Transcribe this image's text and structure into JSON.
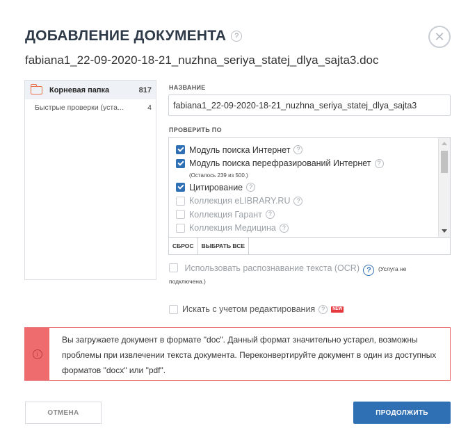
{
  "dialog": {
    "title": "ДОБАВЛЕНИЕ ДОКУМЕНТА",
    "help_icon": "question-icon",
    "close_icon": "close-icon",
    "close_glyph": "✕",
    "filename": "fabiana1_22-09-2020-18-21_nuzhna_seriya_statej_dlya_sajta3.doc"
  },
  "folders": {
    "root": {
      "label": "Корневая папка",
      "count": "817",
      "icon": "folder-icon"
    },
    "items": [
      {
        "label": "Быстрые проверки (уста...",
        "count": "4"
      }
    ]
  },
  "name_section": {
    "label": "НАЗВАНИЕ",
    "value": "fabiana1_22-09-2020-18-21_nuzhna_seriya_statej_dlya_sajta3"
  },
  "check_section": {
    "label": "ПРОВЕРИТЬ ПО",
    "items": [
      {
        "label": "Модуль поиска Интернет",
        "checked": true
      },
      {
        "label": "Модуль поиска перефразирований Интернет",
        "checked": true,
        "note": "(Осталось 239 из 500.)"
      },
      {
        "label": "Цитирование",
        "checked": true
      },
      {
        "label": "Коллекция eLIBRARY.RU",
        "checked": false
      },
      {
        "label": "Коллекция Гарант",
        "checked": false
      },
      {
        "label": "Коллекция Медицина",
        "checked": false
      }
    ],
    "reset_label": "СБРОС",
    "select_all_label": "ВЫБРАТЬ ВСЕ"
  },
  "ocr": {
    "label": "Использовать распознавание текста (OCR)",
    "note_line1": "(Услуга не",
    "note_line2": "подключена.)",
    "help_glyph": "?"
  },
  "edit_search": {
    "label": "Искать с учетом редактирования",
    "badge": "NEW"
  },
  "warning": {
    "icon": "info-icon",
    "glyph": "i",
    "text": "Вы загружаете документ в формате \"doc\". Данный формат значительно устарел, возможны проблемы при извлечении текста документа. Переконвертируйте документ в один из доступных форматов \"docx\" или \"pdf\"."
  },
  "footer": {
    "cancel_label": "ОТМЕНА",
    "continue_label": "ПРОДОЛЖИТЬ"
  },
  "colors": {
    "accent": "#2f6fb4",
    "warning": "#ee6b6e",
    "folder": "#e8704a",
    "badge": "#e5393f"
  }
}
